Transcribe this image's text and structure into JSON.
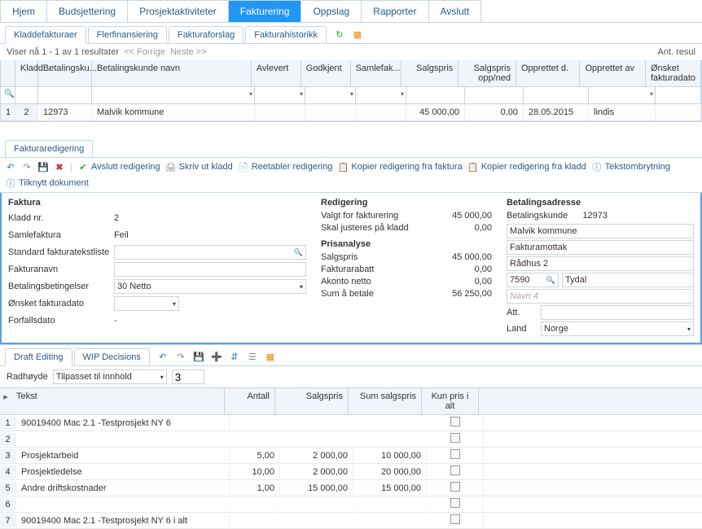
{
  "main_tabs": [
    "Hjem",
    "Budsjettering",
    "Prosjektaktiviteter",
    "Fakturering",
    "Oppslag",
    "Rapporter",
    "Avslutt"
  ],
  "sub_tabs": [
    "Kladdefakturaer",
    "Flerfinansiering",
    "Fakturaforslag",
    "Fakturahistorikk"
  ],
  "results": {
    "showing": "Viser nå 1 - 1 av 1 resultater",
    "prev": "<< Forrige",
    "next": "Neste >>",
    "count_label": "Ant. resul"
  },
  "grid": {
    "headers": {
      "kladd": "Kladd...",
      "betalingsku": "Betalingsku...",
      "betalingskunde_navn": "Betalingskunde navn",
      "avlevert": "Avlevert",
      "godkjent": "Godkjent",
      "samlefak": "Samlefak...",
      "salgspris": "Salgspris",
      "salgspris_oppned": "Salgspris opp/ned",
      "opprettet_d": "Opprettet d.",
      "opprettet_av": "Opprettet av",
      "onsket_fakturadato": "Ønsket fakturadato"
    },
    "row": {
      "idx": "1",
      "kladd": "2",
      "betalingsku": "12973",
      "betalingskunde_navn": "Malvik kommune",
      "salgspris": "45 000,00",
      "oppned": "0,00",
      "opprettet_d": "28.05.2015",
      "opprettet_av": "lindis"
    }
  },
  "panel_tab": "Fakturaredigering",
  "toolbar": {
    "avslutt": "Avslutt redigering",
    "skriv": "Skriv ut kladd",
    "reetabler": "Reetabler redigering",
    "kopier_faktura": "Kopier redigering fra faktura",
    "kopier_kladd": "Kopier redigering fra kladd",
    "tekstombrytning": "Tekstombrytning",
    "tilknytt": "Tilknytt dokument"
  },
  "form": {
    "faktura": {
      "title": "Faktura",
      "kladd_nr_lbl": "Kladd nr.",
      "kladd_nr": "2",
      "samlefaktura_lbl": "Samlefaktura",
      "samlefaktura": "Feil",
      "std_liste_lbl": "Standard fakturatekstliste",
      "fakturanavn_lbl": "Fakturanavn",
      "betalingsbet_lbl": "Betalingsbetingelser",
      "betalingsbet": "30 Netto",
      "onsket_lbl": "Ønsket fakturadato",
      "forfall_lbl": "Forfallsdato",
      "forfall": "-"
    },
    "redigering": {
      "title": "Redigering",
      "valgt_lbl": "Valgt for fakturering",
      "valgt": "45 000,00",
      "justeres_lbl": "Skal justeres på kladd",
      "justeres": "0,00"
    },
    "prisanalyse": {
      "title": "Prisanalyse",
      "salgspris_lbl": "Salgspris",
      "salgspris": "45 000,00",
      "rabatt_lbl": "Fakturarabatt",
      "rabatt": "0,00",
      "akonto_lbl": "Akonto netto",
      "akonto": "0,00",
      "sum_lbl": "Sum å betale",
      "sum": "56 250,00"
    },
    "betaling": {
      "title": "Betalingsadresse",
      "kunde_lbl": "Betalingskunde",
      "kunde": "12973",
      "navn": "Malvik kommune",
      "mottak": "Fakturamottak",
      "adresse": "Rådhus 2",
      "postnr": "7590",
      "sted": "Tydal",
      "navn4_ph": "Navn 4",
      "att_lbl": "Att.",
      "land_lbl": "Land",
      "land": "Norge"
    }
  },
  "bottom_tabs": [
    "Draft Editing",
    "WIP Decisions"
  ],
  "bottom_controls": {
    "radhoyde_lbl": "Radhøyde",
    "radhoyde_val": "Tilpasset til innhold",
    "num": "3"
  },
  "lines": {
    "headers": {
      "tekst": "Tekst",
      "antall": "Antall",
      "salgspris": "Salgspris",
      "sum": "Sum salgspris",
      "kun": "Kun pris i alt"
    },
    "rows": [
      {
        "idx": "1",
        "tekst": "90019400 Mac 2.1 -Testprosjekt NY 6",
        "antall": "",
        "salgspris": "",
        "sum": "",
        "chk": true
      },
      {
        "idx": "2",
        "tekst": "",
        "antall": "",
        "salgspris": "",
        "sum": "",
        "chk": true
      },
      {
        "idx": "3",
        "tekst": "Prosjektarbeid",
        "antall": "5,00",
        "salgspris": "2 000,00",
        "sum": "10 000,00",
        "chk": true
      },
      {
        "idx": "4",
        "tekst": "Prosjektledelse",
        "antall": "10,00",
        "salgspris": "2 000,00",
        "sum": "20 000,00",
        "chk": true
      },
      {
        "idx": "5",
        "tekst": "Andre driftskostnader",
        "antall": "1,00",
        "salgspris": "15 000,00",
        "sum": "15 000,00",
        "chk": true
      },
      {
        "idx": "6",
        "tekst": "",
        "antall": "",
        "salgspris": "",
        "sum": "",
        "chk": true
      },
      {
        "idx": "7",
        "tekst": "90019400 Mac 2.1 -Testprosjekt NY 6 i alt",
        "antall": "",
        "salgspris": "",
        "sum": "",
        "chk": true
      }
    ]
  }
}
